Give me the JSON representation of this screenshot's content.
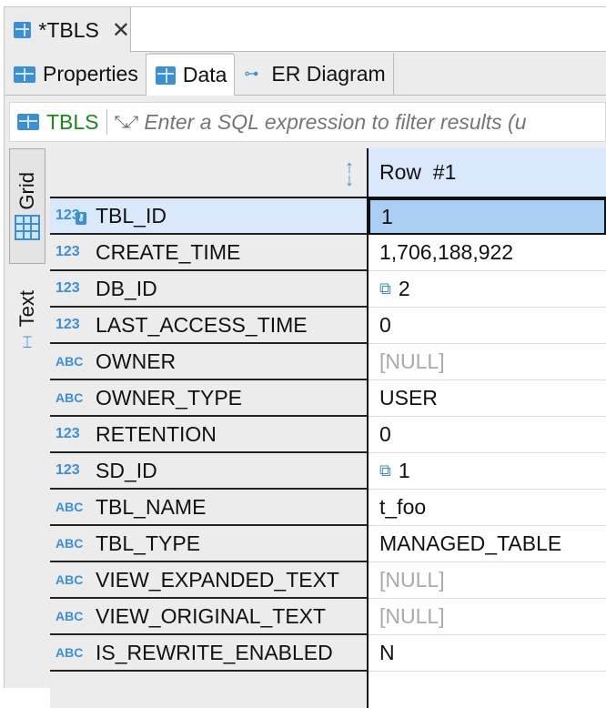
{
  "editor_tab": {
    "title": "*TBLS",
    "close": "✕"
  },
  "subtabs": [
    {
      "label": "Properties",
      "icon": "table-icon"
    },
    {
      "label": "Data",
      "icon": "data-icon",
      "active": true
    },
    {
      "label": "ER Diagram",
      "icon": "er-diagram-icon"
    }
  ],
  "filter": {
    "entity": "TBLS",
    "placeholder": "Enter a SQL expression to filter results (u"
  },
  "view_tabs": {
    "grid": "Grid",
    "text": "Text"
  },
  "grid": {
    "column_header": "Row  #1",
    "rows": [
      {
        "type": "123",
        "name": "TBL_ID",
        "value": "1",
        "key": true,
        "selected": true
      },
      {
        "type": "123",
        "name": "CREATE_TIME",
        "value": "1,706,188,922"
      },
      {
        "type": "123",
        "name": "DB_ID",
        "value": "2",
        "link": true
      },
      {
        "type": "123",
        "name": "LAST_ACCESS_TIME",
        "value": "0"
      },
      {
        "type": "ABC",
        "name": "OWNER",
        "value": "[NULL]",
        "null": true
      },
      {
        "type": "ABC",
        "name": "OWNER_TYPE",
        "value": "USER"
      },
      {
        "type": "123",
        "name": "RETENTION",
        "value": "0"
      },
      {
        "type": "123",
        "name": "SD_ID",
        "value": "1",
        "link": true
      },
      {
        "type": "ABC",
        "name": "TBL_NAME",
        "value": "t_foo"
      },
      {
        "type": "ABC",
        "name": "TBL_TYPE",
        "value": "MANAGED_TABLE"
      },
      {
        "type": "ABC",
        "name": "VIEW_EXPANDED_TEXT",
        "value": "[NULL]",
        "null": true
      },
      {
        "type": "ABC",
        "name": "VIEW_ORIGINAL_TEXT",
        "value": "[NULL]",
        "null": true
      },
      {
        "type": "ABC",
        "name": "IS_REWRITE_ENABLED",
        "value": "N"
      }
    ]
  },
  "colors": {
    "accent": "#3b8fd6",
    "entity": "#1a8a1a",
    "selection": "#aacdf3",
    "header": "#d9e9fb"
  }
}
